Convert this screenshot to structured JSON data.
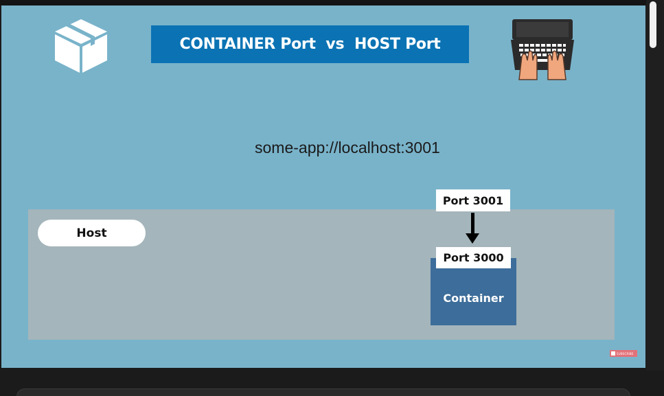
{
  "slide": {
    "title": "CONTAINER Port  vs  HOST Port",
    "url": "some-app://localhost:3001",
    "host_label": "Host",
    "container_label": "Container",
    "host_port_label": "Port 3001",
    "container_port_label": "Port 3000",
    "subscribe_label": "SUBSCRIBE"
  },
  "icons": {
    "box": "box-icon",
    "laptop": "laptop-typing-icon",
    "arrow": "arrow-down-icon"
  },
  "colors": {
    "slide_bg": "#79b3ca",
    "title_banner": "#0b73b4",
    "host_area": "#a4b5bb",
    "container_box": "#3d6d9a",
    "subscribe_badge": "#e2727a"
  }
}
